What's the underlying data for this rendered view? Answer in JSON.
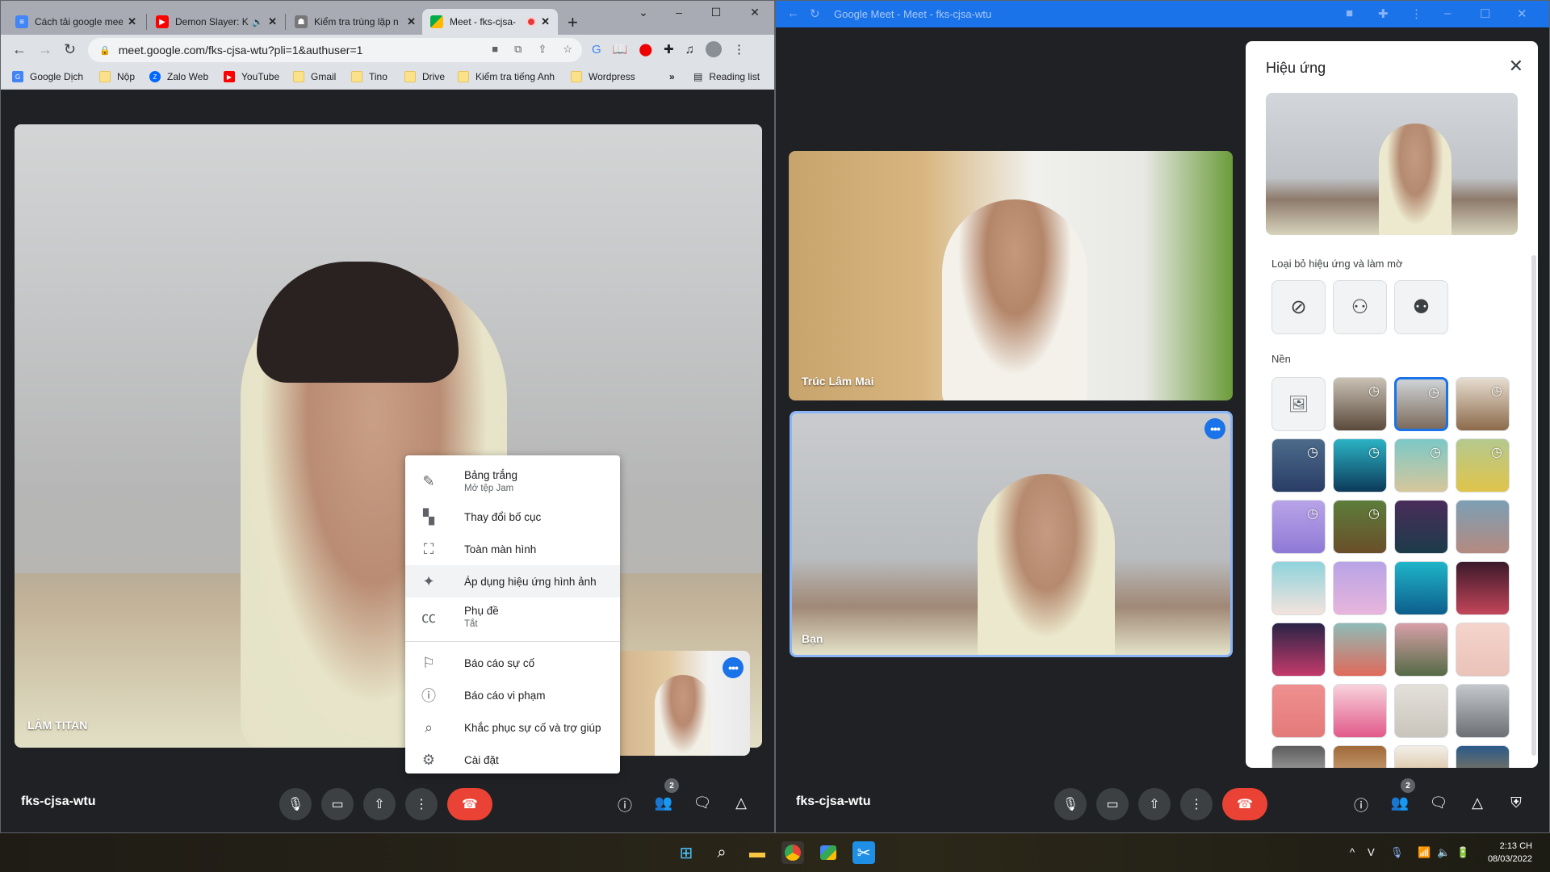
{
  "left_browser": {
    "tabs": [
      {
        "title": "Cách tải google meet",
        "icon": "google-docs-icon",
        "icon_color": "#4285f4"
      },
      {
        "title": "Demon Slayer: K",
        "icon": "youtube-icon",
        "icon_color": "#ff0000",
        "audio": "speaker-icon"
      },
      {
        "title": "Kiểm tra trùng lặp n",
        "icon": "spy-icon",
        "icon_color": "#444444"
      },
      {
        "title": "Meet - fks-cjsa-",
        "icon": "google-meet-icon",
        "icon_color": "#00ac47",
        "recording": "record-icon",
        "active": true
      }
    ],
    "new_tab": "+",
    "window_controls": {
      "tab_search": "⌄",
      "minimize": "–",
      "maximize": "☐",
      "close": "✕"
    },
    "url": "meet.google.com/fks-cjsa-wtu?pli=1&authuser=1",
    "bookmarks": [
      {
        "label": "Google Dịch",
        "icon": "google-translate-icon"
      },
      {
        "label": "Nộp",
        "icon": "folder-icon"
      },
      {
        "label": "Zalo Web",
        "icon": "zalo-icon"
      },
      {
        "label": "YouTube",
        "icon": "youtube-icon"
      },
      {
        "label": "Gmail",
        "icon": "folder-icon"
      },
      {
        "label": "Tino",
        "icon": "folder-icon"
      },
      {
        "label": "Drive",
        "icon": "folder-icon"
      },
      {
        "label": "Kiểm tra tiếng Anh",
        "icon": "folder-icon"
      },
      {
        "label": "Wordpress",
        "icon": "folder-icon"
      }
    ],
    "bookmarks_overflow": "»",
    "reading_list": "Reading list"
  },
  "left_meet": {
    "main_participant": "LÂM TITAN",
    "more_options_glyph": "•••",
    "menu": [
      {
        "label": "Bảng trắng",
        "sub": "Mở tệp Jam",
        "icon": "pencil-icon",
        "glyph": "✎"
      },
      {
        "label": "Thay đổi bố cục",
        "icon": "layout-icon",
        "glyph": "▚"
      },
      {
        "label": "Toàn màn hình",
        "icon": "fullscreen-icon",
        "glyph": "⛶"
      },
      {
        "label": "Áp dụng hiệu ứng hình ảnh",
        "icon": "sparkle-icon",
        "glyph": "✦",
        "highlighted": true
      },
      {
        "label": "Phụ đề",
        "sub": "Tắt",
        "icon": "closed-caption-icon",
        "glyph": "㏄"
      },
      {
        "label": "Báo cáo sự cố",
        "icon": "feedback-icon",
        "glyph": "⚐"
      },
      {
        "label": "Báo cáo vi phạm",
        "icon": "report-icon",
        "glyph": "ⓘ"
      },
      {
        "label": "Khắc phục sự cố và trợ giúp",
        "icon": "troubleshoot-icon",
        "glyph": "⌕"
      },
      {
        "label": "Cài đặt",
        "icon": "settings-icon",
        "glyph": "⚙"
      }
    ],
    "meeting_code": "fks-cjsa-wtu",
    "participants_count": "2"
  },
  "right_pwa": {
    "title": "Google Meet - Meet - fks-cjsa-wtu",
    "tiles": [
      {
        "name": "Trúc Lâm Mai"
      },
      {
        "name": "Bạn"
      }
    ],
    "meeting_code": "fks-cjsa-wtu",
    "participants_count": "2",
    "effects": {
      "title": "Hiệu ứng",
      "section_blur": "Loại bỏ hiệu ứng và làm mờ",
      "section_background": "Nền",
      "blur_options": [
        {
          "name": "no-effect",
          "glyph": "⊘"
        },
        {
          "name": "slight-blur",
          "glyph": "⚇"
        },
        {
          "name": "blur",
          "glyph": "⚉"
        }
      ],
      "backgrounds": [
        {
          "name": "upload-background",
          "colors": [
            "#f1f3f4",
            "#f1f3f4"
          ],
          "glyph": "🖼"
        },
        {
          "name": "cafe-1",
          "colors": [
            "#c9c2b5",
            "#5b4a3c"
          ],
          "animated": true
        },
        {
          "name": "cafe-snow",
          "colors": [
            "#cfd3d6",
            "#7c6b5c"
          ],
          "animated": true,
          "selected": true
        },
        {
          "name": "cafe-3",
          "colors": [
            "#e6ddd0",
            "#8c6a4a"
          ],
          "animated": true
        },
        {
          "name": "car-cartoon",
          "colors": [
            "#4c6b8a",
            "#2a3d66"
          ],
          "animated": true
        },
        {
          "name": "underwater",
          "colors": [
            "#2bb3c4",
            "#0c3a5a"
          ],
          "animated": true
        },
        {
          "name": "beach-cartoon",
          "colors": [
            "#7cc8c8",
            "#d6c79a"
          ],
          "animated": true
        },
        {
          "name": "classroom-cartoon",
          "colors": [
            "#b5c98e",
            "#e0c44a"
          ],
          "animated": true
        },
        {
          "name": "space-cartoon",
          "colors": [
            "#b9a3e8",
            "#8e7ad6"
          ],
          "animated": true
        },
        {
          "name": "forest-cartoon",
          "colors": [
            "#5d7d3a",
            "#6a4e2a"
          ],
          "animated": true
        },
        {
          "name": "theater-cartoon",
          "colors": [
            "#4a2c5a",
            "#1c3c4a"
          ]
        },
        {
          "name": "sunset-gradient",
          "colors": [
            "#7c9fb4",
            "#b48a80"
          ]
        },
        {
          "name": "beach",
          "colors": [
            "#8fd3dc",
            "#f3e3dd"
          ]
        },
        {
          "name": "pastel-clouds",
          "colors": [
            "#b8a3e6",
            "#e8b5dc"
          ]
        },
        {
          "name": "pool-water",
          "colors": [
            "#1fb5c9",
            "#0d5e8c"
          ]
        },
        {
          "name": "nebula",
          "colors": [
            "#3b1a2a",
            "#c4455a"
          ]
        },
        {
          "name": "fireworks",
          "colors": [
            "#2a2346",
            "#c43a6a"
          ]
        },
        {
          "name": "flowers-pink",
          "colors": [
            "#8fbcb8",
            "#e06a5a"
          ]
        },
        {
          "name": "roses",
          "colors": [
            "#d7a0a8",
            "#556b46"
          ]
        },
        {
          "name": "bokeh-pink",
          "colors": [
            "#f4d4cc",
            "#eac2b8"
          ]
        },
        {
          "name": "pattern-pink",
          "colors": [
            "#ef8f8f",
            "#e47a7a"
          ]
        },
        {
          "name": "confetti",
          "colors": [
            "#f7d2dc",
            "#e25a8a"
          ]
        },
        {
          "name": "gallery-wall",
          "colors": [
            "#e3e0da",
            "#c9c5bc"
          ]
        },
        {
          "name": "mountain-room",
          "colors": [
            "#c4c8cc",
            "#6c7074"
          ]
        },
        {
          "name": "bright-window",
          "colors": [
            "#5c5c5c",
            "#d8d8d8"
          ]
        },
        {
          "name": "bookshelf",
          "colors": [
            "#a06a3a",
            "#e6c8a0"
          ]
        },
        {
          "name": "shelf-room",
          "colors": [
            "#f3efe8",
            "#c8a06a"
          ]
        },
        {
          "name": "library-night",
          "colors": [
            "#2a5a8a",
            "#c48a3a"
          ]
        }
      ]
    }
  },
  "controls": {
    "mic": "mic-icon",
    "camera": "camera-icon",
    "present": "present-icon",
    "more": "more-vert-icon",
    "hangup": "hangup-icon",
    "info": "info-icon",
    "people": "people-icon",
    "chat": "chat-icon",
    "activities": "activities-icon",
    "host_controls": "shield-lock-icon"
  },
  "taskbar": {
    "apps": [
      "windows-start-icon",
      "search-icon",
      "file-explorer-icon",
      "chrome-icon",
      "google-meet-app-icon",
      "snipping-tool-icon"
    ],
    "time": "2:13 CH",
    "date": "08/03/2022"
  }
}
